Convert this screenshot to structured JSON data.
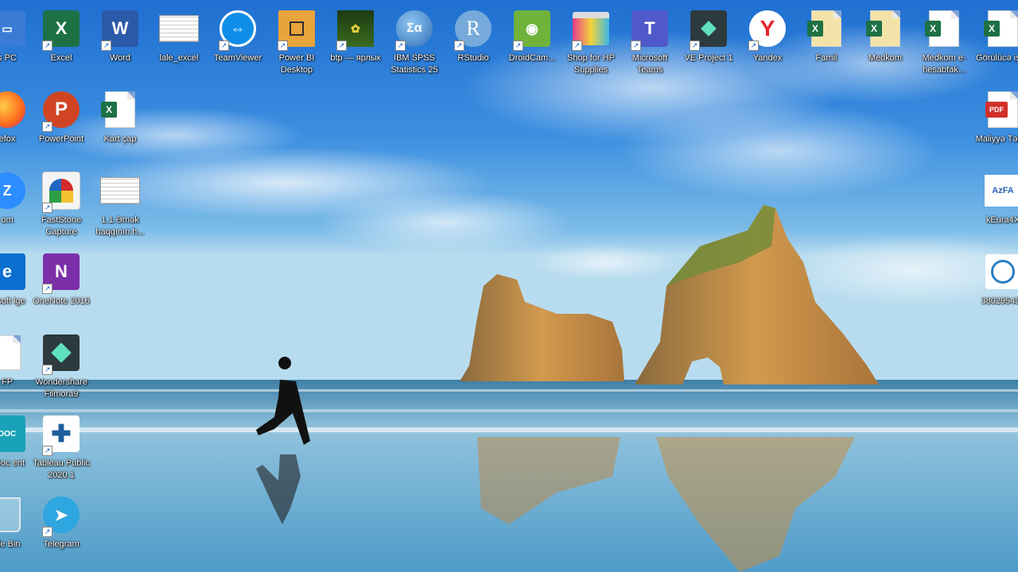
{
  "desktop": {
    "icons": [
      {
        "label": "s PC"
      },
      {
        "label": "Excel"
      },
      {
        "label": "Word"
      },
      {
        "label": "lale_excel"
      },
      {
        "label": "TeamViewer"
      },
      {
        "label": "Power BI Desktop"
      },
      {
        "label": "btp — ярлык"
      },
      {
        "label": "IBM SPSS Statistics 25"
      },
      {
        "label": "RStudio"
      },
      {
        "label": "DroidCam..."
      },
      {
        "label": "Shop for HP Supplies"
      },
      {
        "label": "Microsoft Teams"
      },
      {
        "label": "VE Project 1"
      },
      {
        "label": "Yandex"
      },
      {
        "label": "Famil"
      },
      {
        "label": "Medkom"
      },
      {
        "label": "Medkom e-hesabfak..."
      },
      {
        "label": "Görülücə işlər"
      },
      {
        "label": "efox"
      },
      {
        "label": "PowerPoint"
      },
      {
        "label": "Kart çap"
      },
      {
        "label": "Maliyyə Təhlili"
      },
      {
        "label": "om"
      },
      {
        "label": "FastStone Capture"
      },
      {
        "label": "1.1.Əmək haqqının h..."
      },
      {
        "label": "kEura4X"
      },
      {
        "label": "rosoft lge"
      },
      {
        "label": "OneNote 2016"
      },
      {
        "label": "38029543_"
      },
      {
        "label": "FP"
      },
      {
        "label": "Wondershare Filmora9"
      },
      {
        "label": "nDoc ent"
      },
      {
        "label": "Tableau Public 2020.1"
      },
      {
        "label": "cle Bin"
      },
      {
        "label": "Telegram"
      }
    ],
    "icon_glyphs": {
      "excel": "X",
      "word": "W",
      "powerpoint": "P",
      "onenote": "N",
      "teams": "T",
      "rstudio": "R",
      "yandex": "Y",
      "spss": "Σα",
      "pdf": "PDF",
      "azfa": "AzFA",
      "zoom": "Z",
      "edge": "e"
    }
  }
}
